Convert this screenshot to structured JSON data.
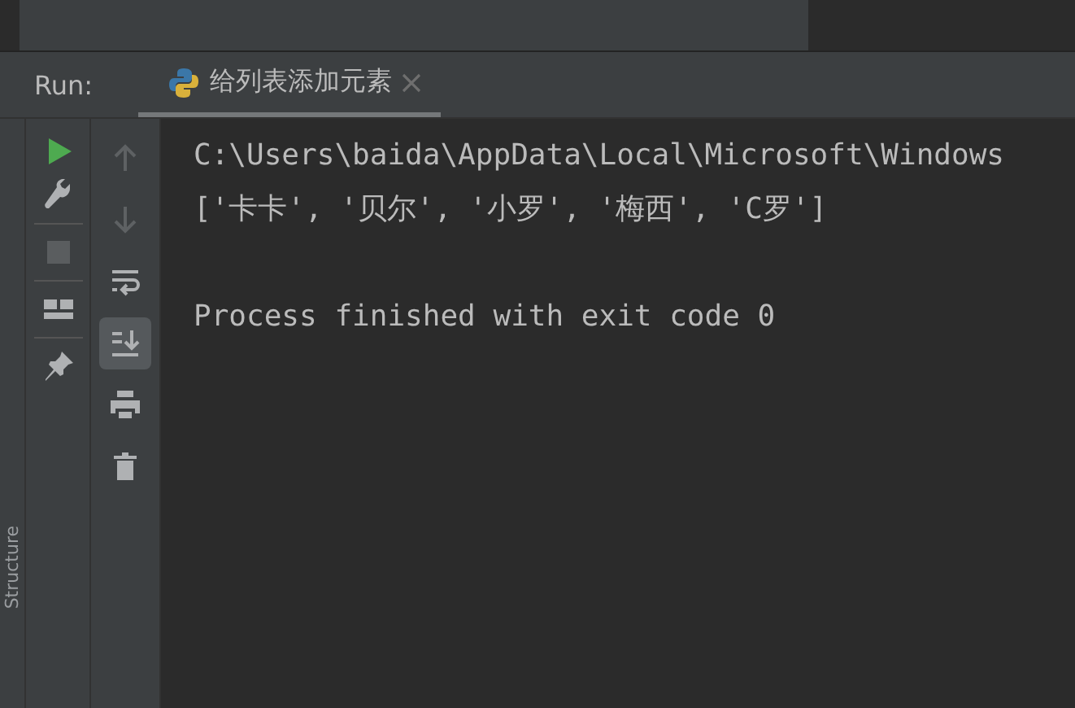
{
  "run_bar": {
    "label": "Run:",
    "tab": {
      "title": "给列表添加元素",
      "selected": true
    }
  },
  "left_toolbar": [
    {
      "kind": "run"
    },
    {
      "kind": "wrench"
    },
    {
      "kind": "divider"
    },
    {
      "kind": "stop"
    },
    {
      "kind": "divider"
    },
    {
      "kind": "layout"
    },
    {
      "kind": "divider"
    },
    {
      "kind": "pin"
    }
  ],
  "console_toolbar": [
    {
      "kind": "up",
      "selected": false
    },
    {
      "kind": "down",
      "selected": false
    },
    {
      "kind": "wrap",
      "selected": false
    },
    {
      "kind": "scroll-end",
      "selected": true
    },
    {
      "kind": "print",
      "selected": false
    },
    {
      "kind": "trash",
      "selected": false
    }
  ],
  "side_tab": "Structure",
  "console": {
    "output": [
      "C:\\Users\\baida\\AppData\\Local\\Microsoft\\Windows",
      "['卡卡', '贝尔', '小罗', '梅西', 'C罗']"
    ],
    "exit_message": "Process finished with exit code 0"
  }
}
